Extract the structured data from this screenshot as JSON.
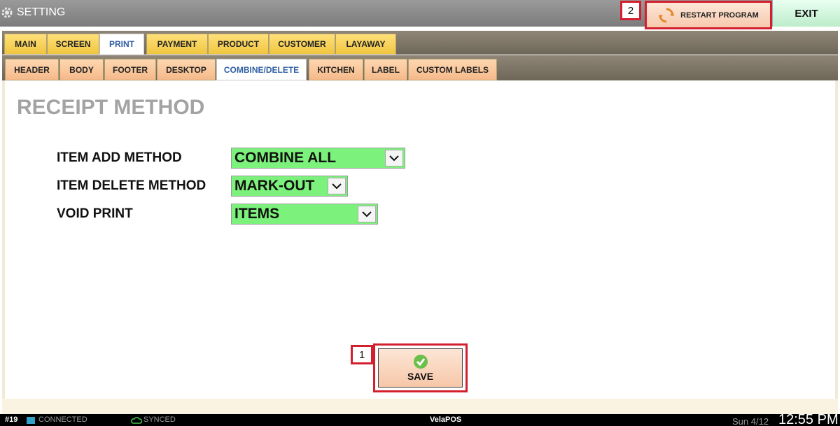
{
  "titlebar": {
    "title": "SETTING",
    "restart_label": "RESTART PROGRAM",
    "exit_label": "EXIT"
  },
  "callouts": [
    "1",
    "2"
  ],
  "main_tabs": [
    "MAIN",
    "SCREEN",
    "PRINT",
    "PAYMENT",
    "PRODUCT",
    "CUSTOMER",
    "LAYAWAY"
  ],
  "main_tab_active": "PRINT",
  "sub_tabs": [
    "HEADER",
    "BODY",
    "FOOTER",
    "DESKTOP",
    "COMBINE/DELETE",
    "KITCHEN",
    "LABEL",
    "CUSTOM LABELS"
  ],
  "sub_tab_active": "COMBINE/DELETE",
  "section": {
    "title": "RECEIPT METHOD"
  },
  "fields": [
    {
      "label": "ITEM ADD METHOD",
      "value": "COMBINE ALL"
    },
    {
      "label": "ITEM DELETE METHOD",
      "value": "MARK-OUT"
    },
    {
      "label": "VOID PRINT",
      "value": "ITEMS"
    }
  ],
  "save": {
    "label": "SAVE"
  },
  "status": {
    "station": "#19",
    "connection": "CONNECTED",
    "sync": "SYNCED",
    "app": "VelaPOS",
    "date": "Sun 4/12",
    "time": "12:55 PM"
  },
  "colors": {
    "field_bg": "#7cf27c",
    "callout_red": "#d3202f",
    "tab_yellow": "#f0c640",
    "tab_peach": "#f5b98a"
  }
}
